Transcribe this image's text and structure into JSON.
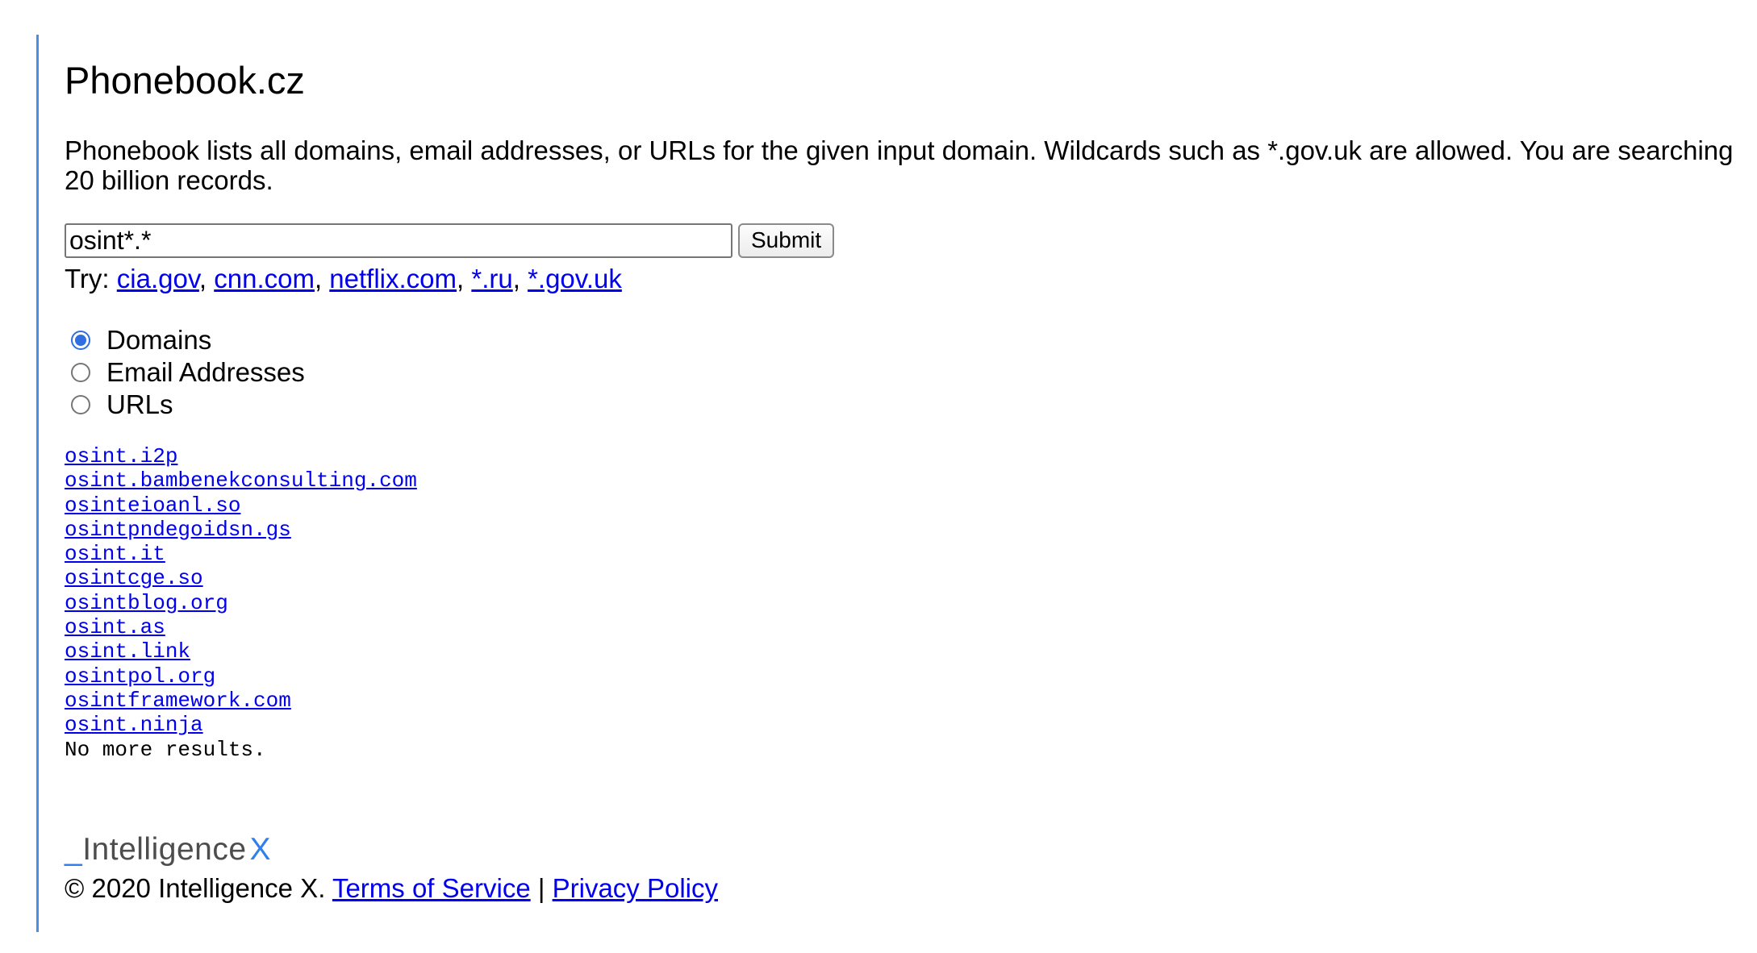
{
  "page": {
    "title": "Phonebook.cz",
    "description": "Phonebook lists all domains, email addresses, or URLs for the given input domain. Wildcards such as *.gov.uk are allowed. You are searching 20 billion records."
  },
  "search": {
    "value": "osint*.*",
    "submit_label": "Submit"
  },
  "try": {
    "label": "Try:",
    "links": [
      "cia.gov",
      "cnn.com",
      "netflix.com",
      "*.ru",
      "*.gov.uk"
    ]
  },
  "options": {
    "selected": "Domains",
    "items": [
      "Domains",
      "Email Addresses",
      "URLs"
    ]
  },
  "results": {
    "items": [
      "osint.i2p",
      "osint.bambenekconsulting.com",
      "osinteioanl.so",
      "osintpndegoidsn.gs",
      "osint.it",
      "osintcge.so",
      "osintblog.org",
      "osint.as",
      "osint.link",
      "osintpol.org",
      "osintframework.com",
      "osint.ninja"
    ],
    "end_text": "No more results."
  },
  "logo": {
    "underscore": "_",
    "text": "Intelligence",
    "x": "X"
  },
  "footer": {
    "copyright": "© 2020 Intelligence X.",
    "terms_label": "Terms of Service",
    "separator": "|",
    "privacy_label": "Privacy Policy"
  },
  "colors": {
    "link": "#0000ee",
    "accent": "#2f80ed",
    "rule": "#4a8fe7"
  }
}
